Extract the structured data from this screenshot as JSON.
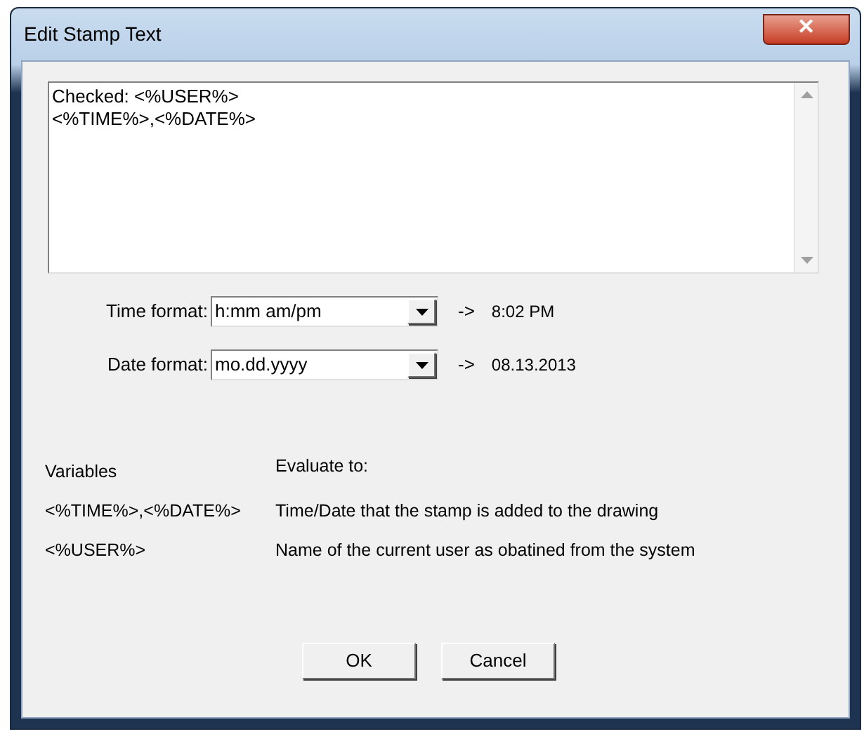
{
  "window": {
    "title": "Edit Stamp Text",
    "close": "✕"
  },
  "stamp_text": [
    "Checked: <%USER%>",
    "<%TIME%>,<%DATE%>"
  ],
  "formats": [
    {
      "label": "Time format:",
      "value": "h:mm am/pm",
      "arrow": "->",
      "result": "8:02 PM"
    },
    {
      "label": "Date format:",
      "value": "mo.dd.yyyy",
      "arrow": "->",
      "result": "08.13.2013"
    }
  ],
  "variables": {
    "heading": "Variables",
    "evaluate_heading": "Evaluate to:",
    "rows": [
      {
        "variable": "<%TIME%>,<%DATE%>",
        "meaning": "Time/Date that the stamp is added to the drawing"
      },
      {
        "variable": "<%USER%>",
        "meaning": "Name of the current user as obatined from the system"
      }
    ]
  },
  "buttons": [
    "OK",
    "Cancel"
  ]
}
